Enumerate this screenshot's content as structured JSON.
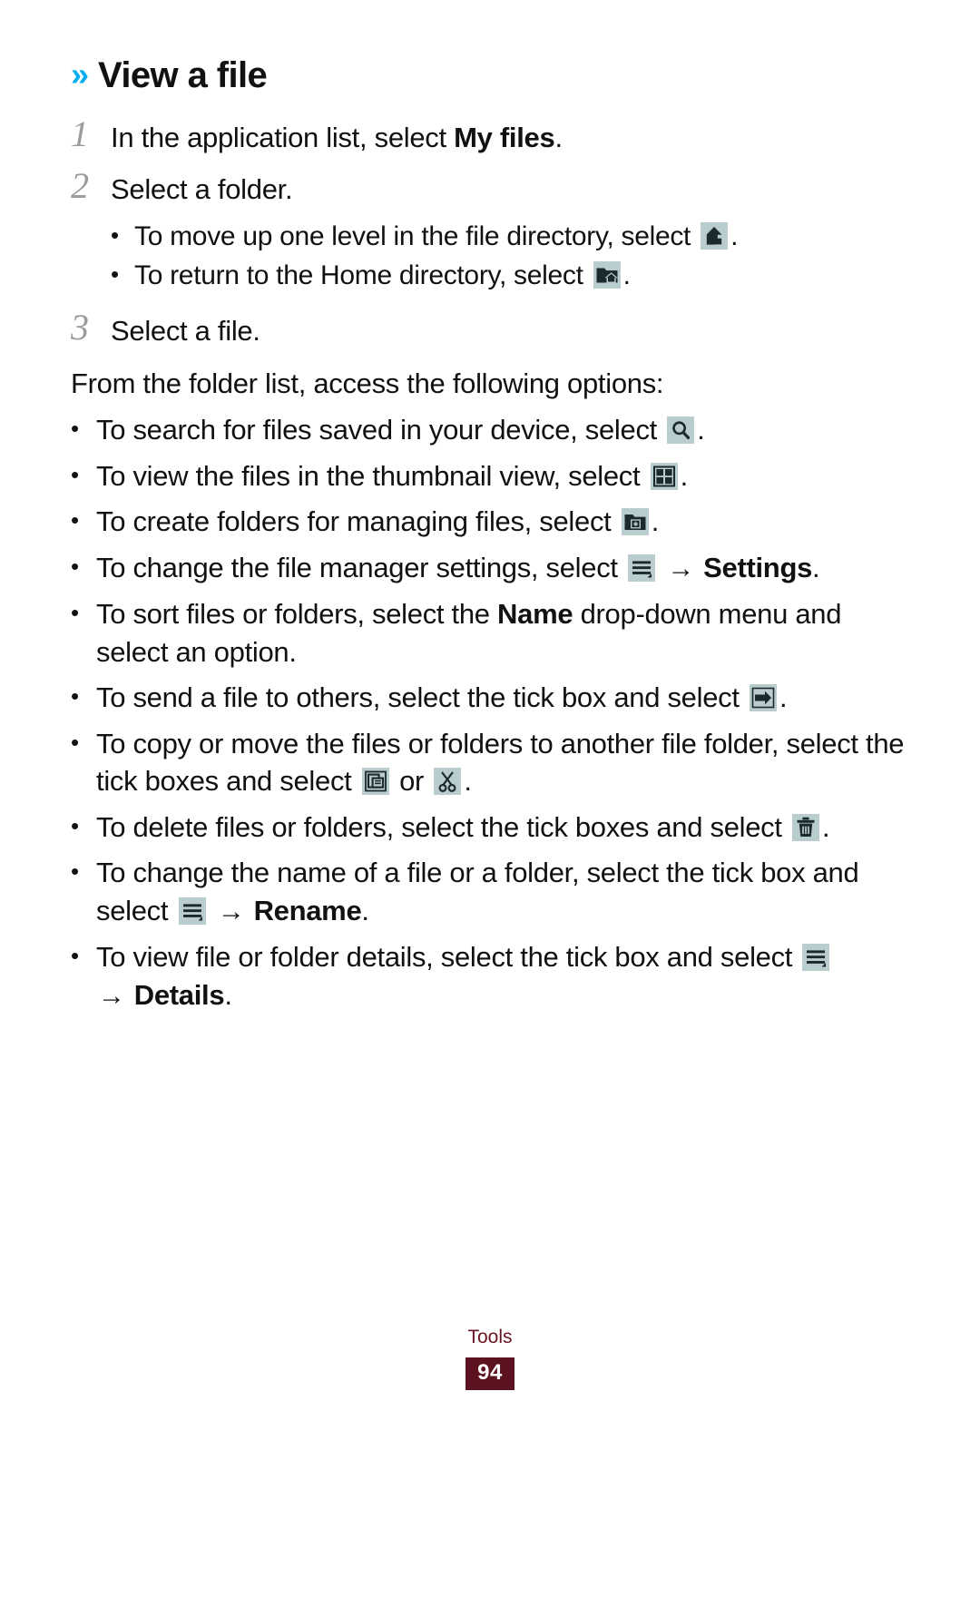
{
  "heading": {
    "chevron": "»",
    "title": "View a file"
  },
  "steps": [
    {
      "num": "1",
      "text_before": "In the application list, select ",
      "bold": "My files",
      "text_after": "."
    },
    {
      "num": "2",
      "text_before": "Select a folder.",
      "bold": "",
      "text_after": ""
    },
    {
      "num": "3",
      "text_before": "Select a file.",
      "bold": "",
      "text_after": ""
    }
  ],
  "substeps": [
    {
      "bullet": "•",
      "text_before": "To move up one level in the file directory, select ",
      "icon": "move-up-level-icon",
      "text_after": "."
    },
    {
      "bullet": "•",
      "text_before": "To return to the Home directory, select ",
      "icon": "home-directory-icon",
      "text_after": "."
    }
  ],
  "intro_paragraph": "From the folder list, access the following options:",
  "options": [
    {
      "bullet": "•",
      "parts": [
        {
          "type": "text",
          "value": "To search for files saved in your device, select "
        },
        {
          "type": "icon",
          "value": "search-icon"
        },
        {
          "type": "text",
          "value": "."
        }
      ]
    },
    {
      "bullet": "•",
      "parts": [
        {
          "type": "text",
          "value": "To view the files in the thumbnail view, select "
        },
        {
          "type": "icon",
          "value": "thumbnail-view-icon"
        },
        {
          "type": "text",
          "value": "."
        }
      ]
    },
    {
      "bullet": "•",
      "parts": [
        {
          "type": "text",
          "value": "To create folders for managing files, select "
        },
        {
          "type": "icon",
          "value": "new-folder-icon"
        },
        {
          "type": "text",
          "value": "."
        }
      ]
    },
    {
      "bullet": "•",
      "parts": [
        {
          "type": "text",
          "value": "To change the file manager settings, select "
        },
        {
          "type": "icon",
          "value": "options-menu-icon"
        },
        {
          "type": "text",
          "value": " "
        },
        {
          "type": "arrow",
          "value": "→"
        },
        {
          "type": "bold",
          "value": "Settings"
        },
        {
          "type": "text",
          "value": "."
        }
      ]
    },
    {
      "bullet": "•",
      "parts": [
        {
          "type": "text",
          "value": "To sort files or folders, select the "
        },
        {
          "type": "bold",
          "value": "Name"
        },
        {
          "type": "text",
          "value": " drop-down menu and select an option."
        }
      ]
    },
    {
      "bullet": "•",
      "parts": [
        {
          "type": "text",
          "value": "To send a file to others, select the tick box and select "
        },
        {
          "type": "icon",
          "value": "send-icon"
        },
        {
          "type": "text",
          "value": "."
        }
      ]
    },
    {
      "bullet": "•",
      "parts": [
        {
          "type": "text",
          "value": "To copy or move the files or folders to another file folder, select the tick boxes and select "
        },
        {
          "type": "icon",
          "value": "copy-icon"
        },
        {
          "type": "text",
          "value": " or "
        },
        {
          "type": "icon",
          "value": "cut-icon"
        },
        {
          "type": "text",
          "value": "."
        }
      ]
    },
    {
      "bullet": "•",
      "parts": [
        {
          "type": "text",
          "value": "To delete files or folders, select the tick boxes and select "
        },
        {
          "type": "icon",
          "value": "delete-icon"
        },
        {
          "type": "text",
          "value": "."
        }
      ]
    },
    {
      "bullet": "•",
      "parts": [
        {
          "type": "text",
          "value": "To change the name of a file or a folder, select the tick box and select "
        },
        {
          "type": "icon",
          "value": "options-menu-icon"
        },
        {
          "type": "text",
          "value": " "
        },
        {
          "type": "arrow",
          "value": "→"
        },
        {
          "type": "bold",
          "value": "Rename"
        },
        {
          "type": "text",
          "value": "."
        }
      ]
    },
    {
      "bullet": "•",
      "parts": [
        {
          "type": "text",
          "value": "To view file or folder details, select the tick box and select "
        },
        {
          "type": "icon",
          "value": "options-menu-icon"
        },
        {
          "type": "newline",
          "value": ""
        },
        {
          "type": "arrow",
          "value": "→"
        },
        {
          "type": "bold",
          "value": "Details"
        },
        {
          "type": "text",
          "value": "."
        }
      ]
    }
  ],
  "footer": {
    "section": "Tools",
    "page_number": "94"
  },
  "colors": {
    "chevron_accent": "#00AEEF",
    "icon_chip_background": "#B9CCCE",
    "icon_glyph": "#1b2a2c",
    "footer_text": "#6B1421",
    "page_badge_background": "#5D1220",
    "step_number": "#9B9B9B",
    "body_text": "#111111"
  }
}
